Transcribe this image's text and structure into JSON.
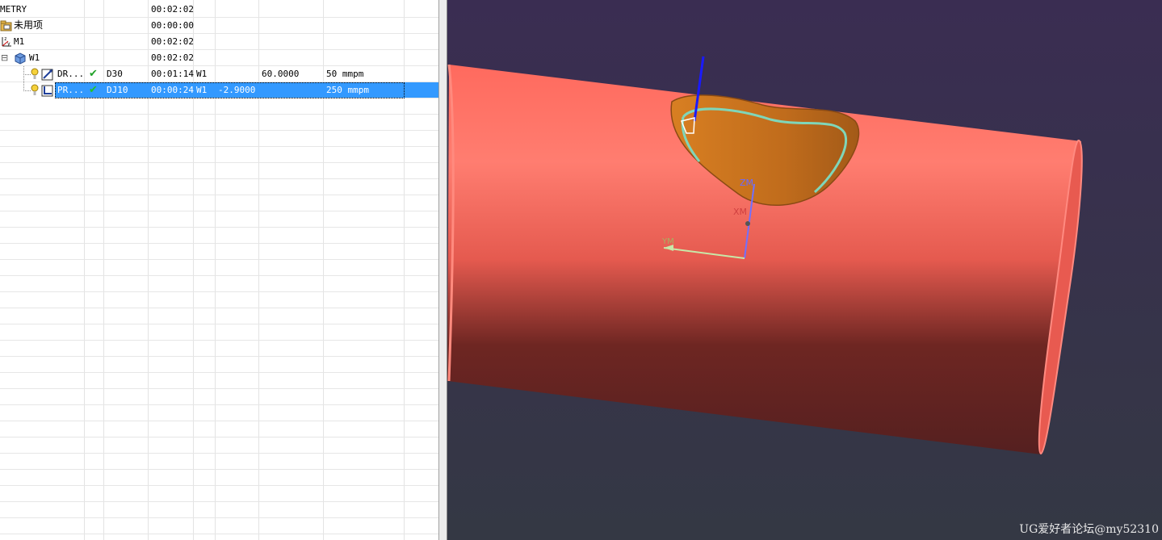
{
  "navigator": {
    "rows": [
      {
        "name": "METRY",
        "check": "",
        "tool": "",
        "time": "00:02:02",
        "geom": "",
        "stock": "",
        "depth": "",
        "feed": ""
      },
      {
        "name": "未用项",
        "check": "",
        "tool": "",
        "time": "00:00:00",
        "geom": "",
        "stock": "",
        "depth": "",
        "feed": ""
      },
      {
        "name": "M1",
        "check": "",
        "tool": "",
        "time": "00:02:02",
        "geom": "",
        "stock": "",
        "depth": "",
        "feed": ""
      },
      {
        "name": "W1",
        "check": "",
        "tool": "",
        "time": "00:02:02",
        "geom": "",
        "stock": "",
        "depth": "",
        "feed": ""
      },
      {
        "name": "DR...",
        "check": "✔",
        "tool": "D30",
        "time": "00:01:14",
        "geom": "W1",
        "stock": "",
        "depth": "60.0000",
        "feed": "50 mmpm"
      },
      {
        "name": "PR...",
        "check": "✔",
        "tool": "DJ10",
        "time": "00:00:24",
        "geom": "W1",
        "stock": "-2.9000",
        "depth": "",
        "feed": "250 mmpm"
      }
    ],
    "expander": "⊟"
  },
  "viewport": {
    "axes": {
      "zm": "ZM",
      "xm": "XM",
      "ym": "YM"
    },
    "colors": {
      "background_top": "#3a2d52",
      "background_bottom": "#343844",
      "pipe": "#ff6a5e",
      "pocket": "#d27a22",
      "toolpath": "#7fd6b9",
      "tool_axis": "#1a1aff"
    }
  },
  "watermark": "UG爱好者论坛@my52310"
}
